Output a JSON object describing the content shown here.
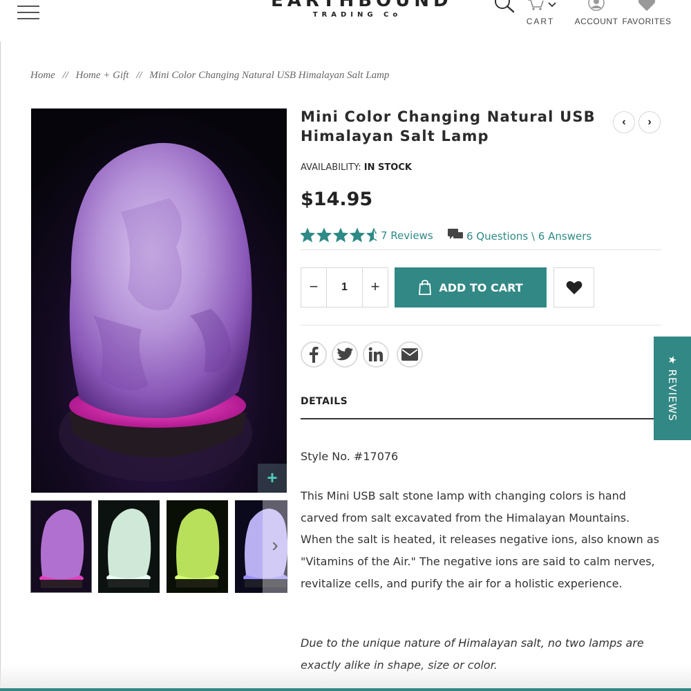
{
  "header": {
    "logo_main": "EARTHBOUND",
    "logo_sub": "TRADING Co",
    "cart_label": "CART",
    "account_label": "ACCOUNT",
    "favorites_label": "FAVORITES",
    "icons": [
      "menu-icon",
      "search-icon",
      "cart-icon",
      "chevron-down-icon",
      "account-icon",
      "heart-icon"
    ]
  },
  "breadcrumb": {
    "items": [
      "Home",
      "Home + Gift",
      "Mini Color Changing Natural USB Himalayan Salt Lamp"
    ],
    "separator": "//"
  },
  "gallery": {
    "zoom_label": "+",
    "thumb_next_label": "›",
    "thumbnail_colors": [
      "#b070d0",
      "#cfe8d8",
      "#b8e05a",
      "#b8b0f0"
    ]
  },
  "product": {
    "title": "Mini Color Changing Natural USB Himalayan Salt Lamp",
    "prev_label": "‹",
    "next_label": "›",
    "availability_label": "AVAILABILITY:",
    "availability_value": "IN STOCK",
    "price": "$14.95",
    "rating": 4.5,
    "reviews_text": "7 Reviews",
    "qa_text": "6 Questions \\ 6 Answers",
    "quantity": "1",
    "qty_minus": "−",
    "qty_plus": "+",
    "add_to_cart": "ADD TO CART",
    "share_icons": [
      "facebook-icon",
      "twitter-icon",
      "linkedin-icon",
      "email-icon"
    ],
    "details_tab": "DETAILS",
    "style_no": "Style No. #17076",
    "description": "This Mini USB salt stone lamp with changing colors is hand carved from salt excavated from the Himalayan Mountains. When the salt is heated, it releases negative ions, also known as \"Vitamins of the Air.\" The negative ions are said to calm nerves, revitalize cells, and purify the air for a holistic experience.",
    "note": "Due to the unique nature of Himalayan salt, no two lamps are exactly alike in shape, size or color."
  },
  "reviews_tab": {
    "label": "★ REVIEWS"
  },
  "colors": {
    "accent": "#328884",
    "text_dark": "#2b2b2b",
    "link_teal": "#2f8a86"
  }
}
